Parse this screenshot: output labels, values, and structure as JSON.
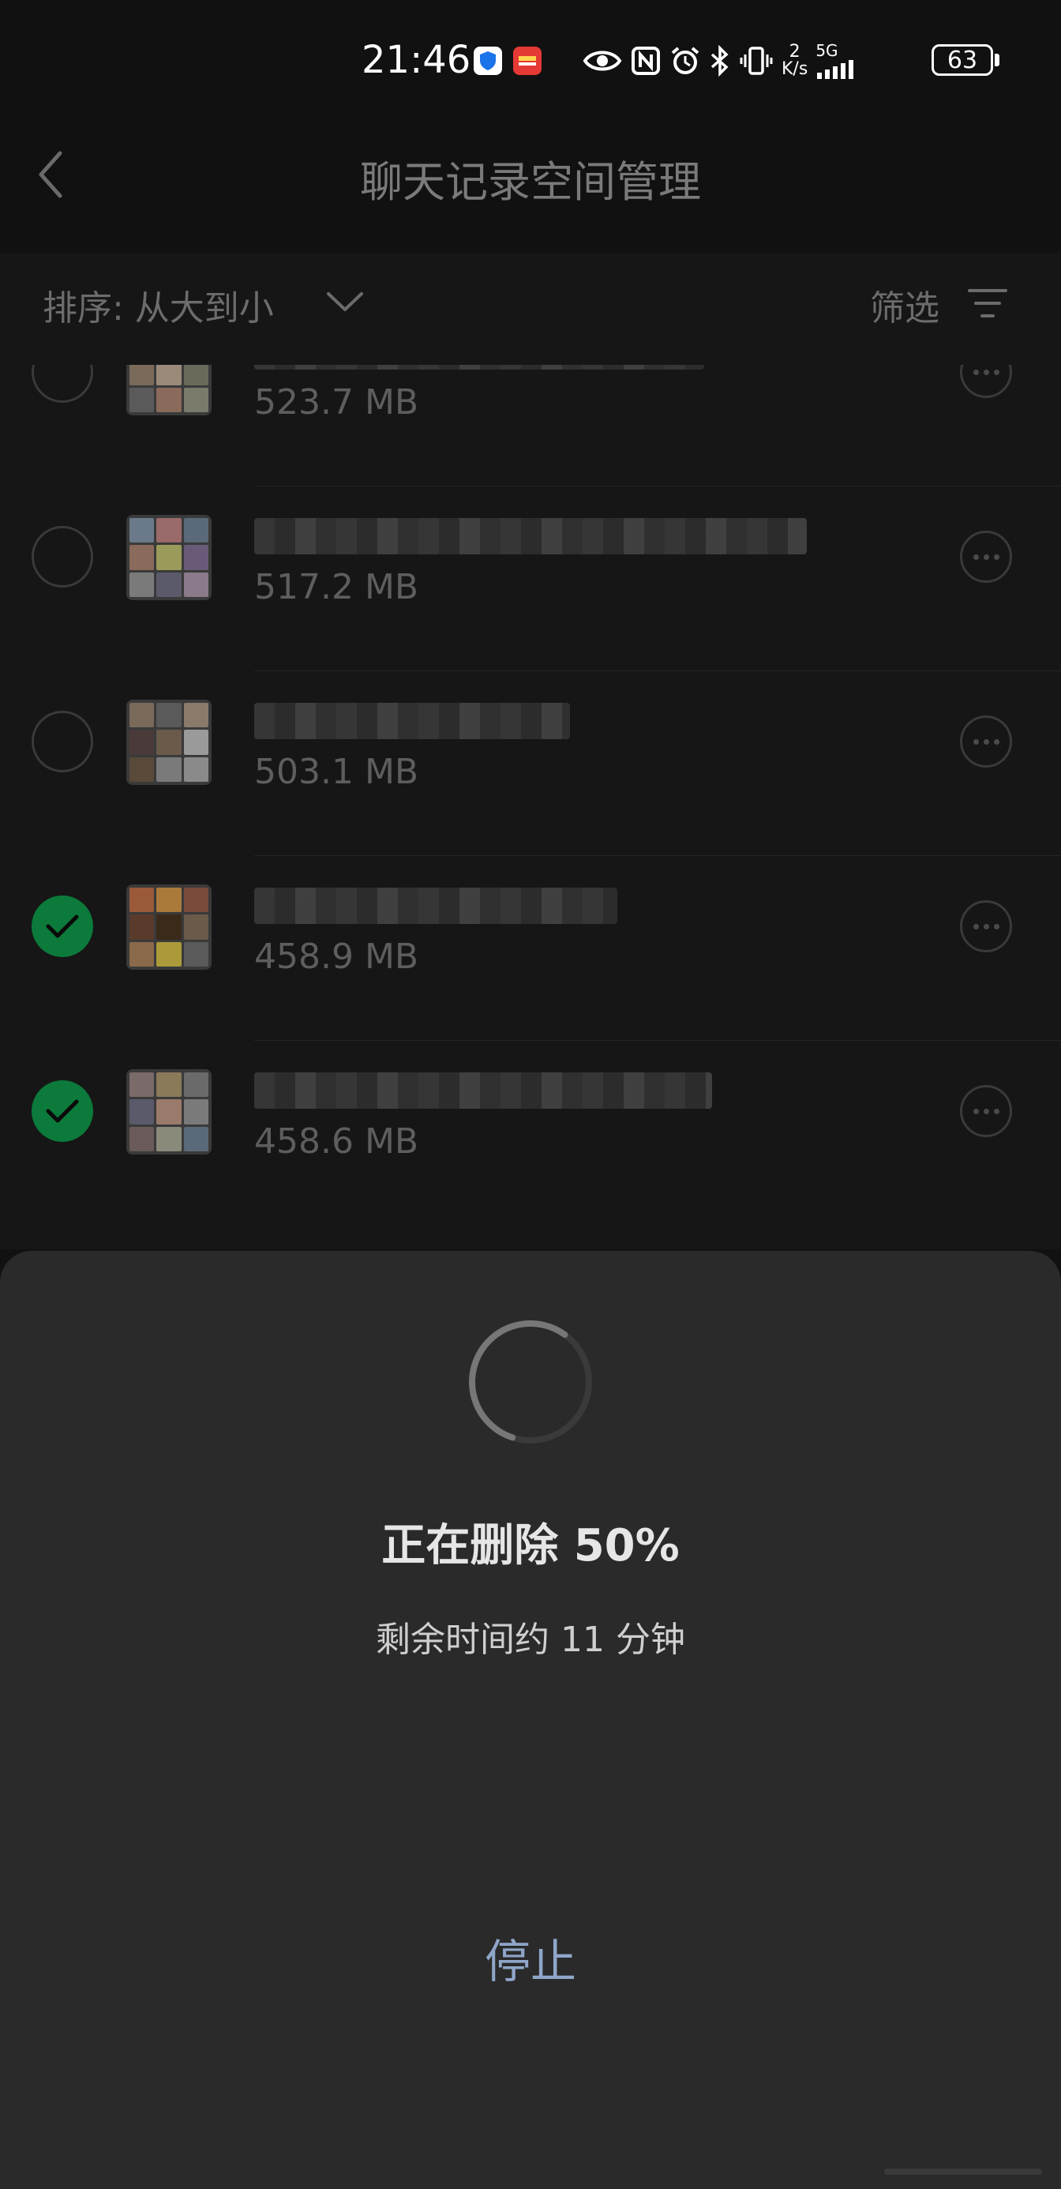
{
  "status_bar": {
    "time": "21:46",
    "speed_value": "2",
    "speed_unit": "K/s",
    "network": "5G",
    "battery": "63"
  },
  "header": {
    "title": "聊天记录空间管理"
  },
  "sort_bar": {
    "sort_label": "排序:  从大到小",
    "filter_label": "筛选"
  },
  "list": {
    "items": [
      {
        "size": "523.7 MB",
        "selected": false
      },
      {
        "size": "517.2 MB",
        "selected": false
      },
      {
        "size": "503.1 MB",
        "selected": false
      },
      {
        "size": "458.9 MB",
        "selected": true
      },
      {
        "size": "458.6 MB",
        "selected": true
      }
    ]
  },
  "sheet": {
    "progress": "正在删除 50%",
    "progress_percent": 50,
    "remaining": "剩余时间约 11 分钟",
    "stop_label": "停止"
  },
  "colors": {
    "checked_green": "#0b7a3a",
    "stop_blue": "#8fa6c9",
    "sheet_bg": "#2a2a2a"
  }
}
